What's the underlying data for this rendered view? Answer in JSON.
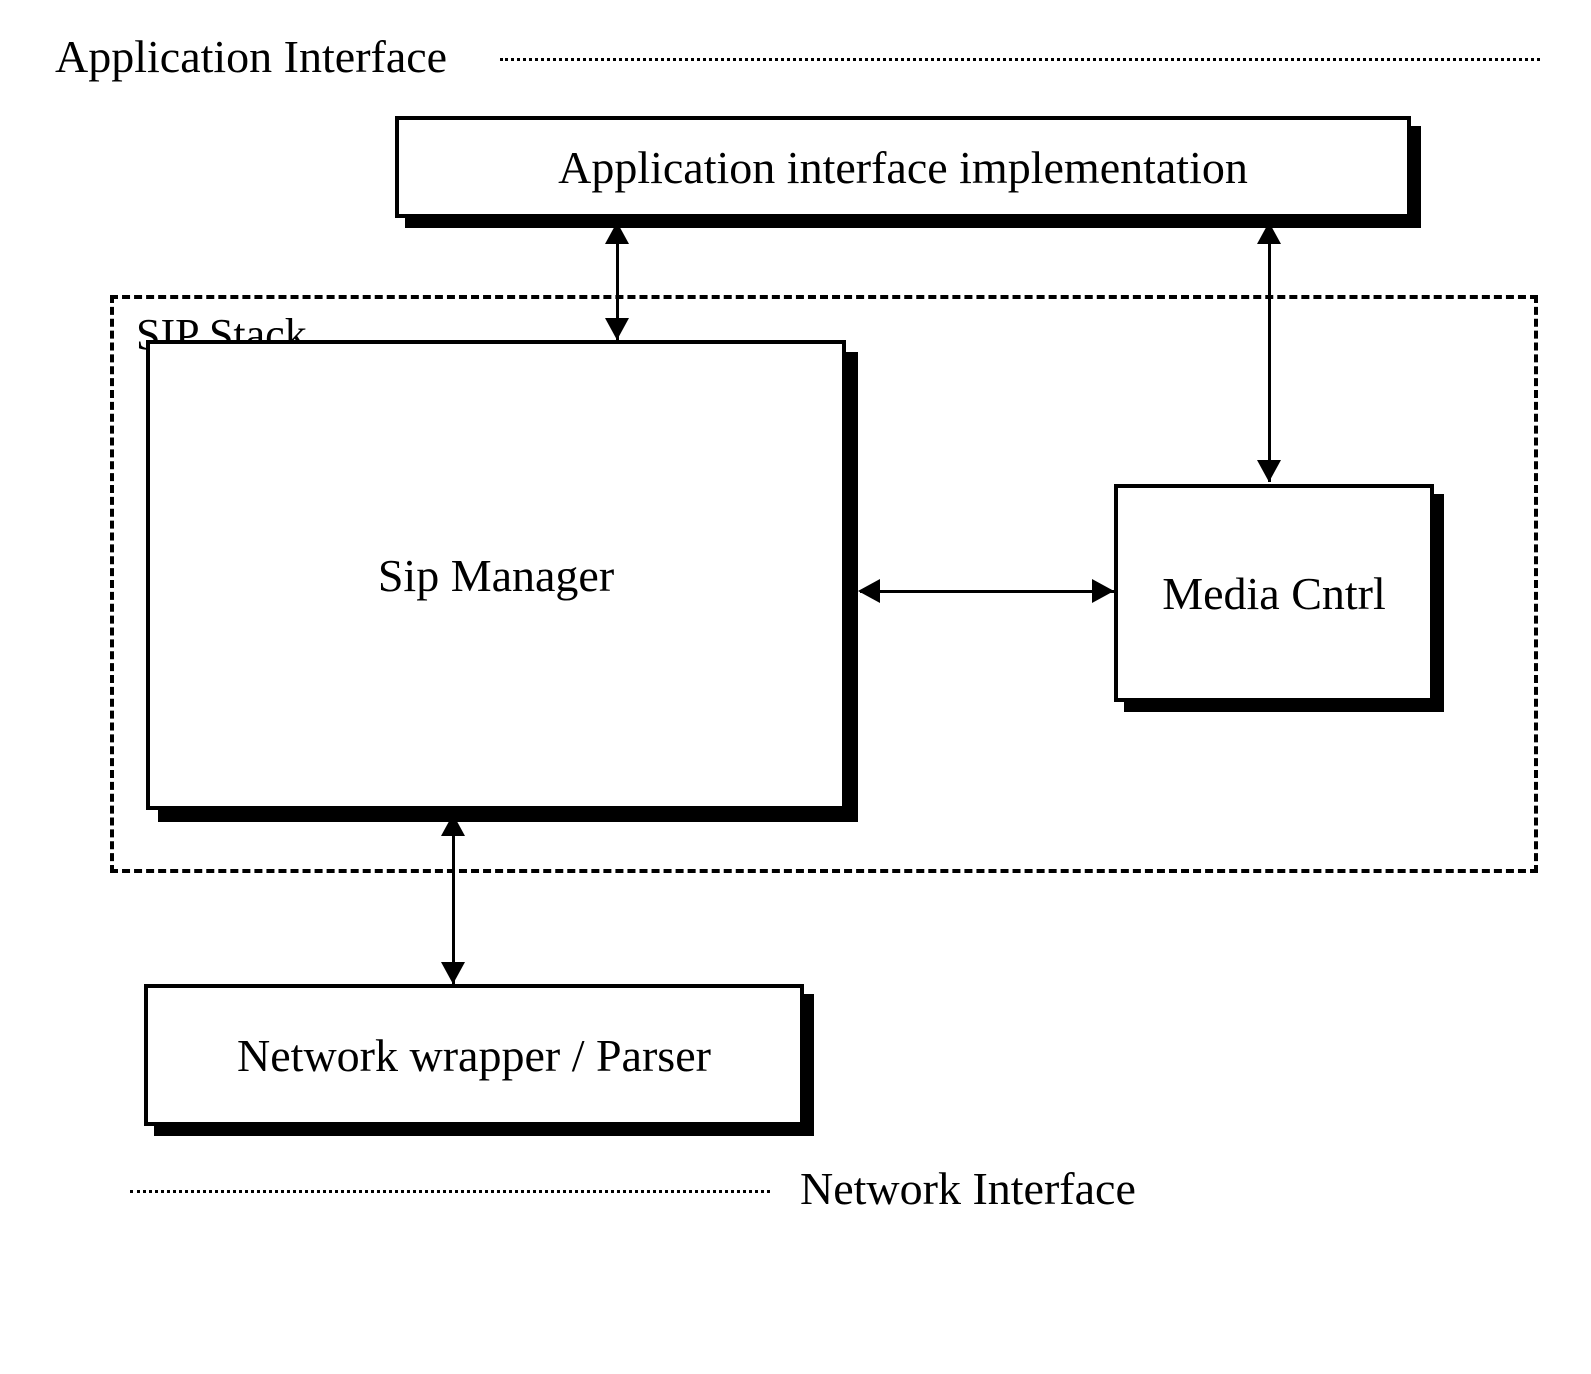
{
  "labels": {
    "application_interface": "Application Interface",
    "network_interface": "Network Interface",
    "sip_stack": "SIP Stack"
  },
  "boxes": {
    "app_impl": "Application interface implementation",
    "sip_manager": "Sip Manager",
    "media_cntrl": "Media Cntrl",
    "network_wrapper": "Network wrapper / Parser"
  },
  "connections": [
    {
      "from": "app_impl",
      "to": "sip_manager",
      "bidirectional": true
    },
    {
      "from": "app_impl",
      "to": "media_cntrl",
      "bidirectional": true
    },
    {
      "from": "sip_manager",
      "to": "media_cntrl",
      "bidirectional": true
    },
    {
      "from": "sip_manager",
      "to": "network_wrapper",
      "bidirectional": true
    }
  ]
}
